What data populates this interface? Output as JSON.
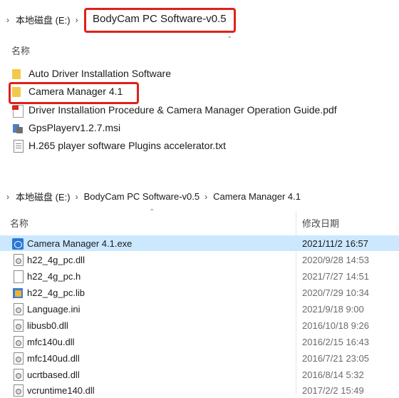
{
  "top": {
    "breadcrumb": [
      "本地磁盘 (E:)",
      "BodyCam PC Software-v0.5"
    ],
    "column_header": "名称",
    "items": [
      {
        "icon": "folder-icon",
        "label": "Auto Driver Installation Software"
      },
      {
        "icon": "folder-icon",
        "label": "Camera Manager 4.1"
      },
      {
        "icon": "pdf-icon",
        "label": "Driver Installation Procedure & Camera Manager Operation Guide.pdf"
      },
      {
        "icon": "msi-icon",
        "label": "GpsPlayerv1.2.7.msi"
      },
      {
        "icon": "text-file-icon",
        "label": "H.265 player software Plugins accelerator.txt"
      }
    ],
    "highlight_color": "#e0201b"
  },
  "bottom": {
    "breadcrumb": [
      "本地磁盘 (E:)",
      "BodyCam PC Software-v0.5",
      "Camera Manager 4.1"
    ],
    "columns": {
      "name": "名称",
      "date": "修改日期"
    },
    "files": [
      {
        "icon": "exe-icon",
        "name": "Camera Manager 4.1.exe",
        "date": "2021/11/2 16:57"
      },
      {
        "icon": "dll-file-icon",
        "name": "h22_4g_pc.dll",
        "date": "2020/9/28 14:53"
      },
      {
        "icon": "blank-file-icon",
        "name": "h22_4g_pc.h",
        "date": "2021/7/27 14:51"
      },
      {
        "icon": "lib-file-icon",
        "name": "h22_4g_pc.lib",
        "date": "2020/7/29 10:34"
      },
      {
        "icon": "settings-file-icon",
        "name": "Language.ini",
        "date": "2021/9/18 9:00"
      },
      {
        "icon": "dll-file-icon",
        "name": "libusb0.dll",
        "date": "2016/10/18 9:26"
      },
      {
        "icon": "dll-file-icon",
        "name": "mfc140u.dll",
        "date": "2016/2/15 16:43"
      },
      {
        "icon": "dll-file-icon",
        "name": "mfc140ud.dll",
        "date": "2016/7/21 23:05"
      },
      {
        "icon": "dll-file-icon",
        "name": "ucrtbased.dll",
        "date": "2016/8/14 5:32"
      },
      {
        "icon": "dll-file-icon",
        "name": "vcruntime140.dll",
        "date": "2017/2/2 15:49"
      }
    ],
    "selected_color": "#cce8ff"
  }
}
